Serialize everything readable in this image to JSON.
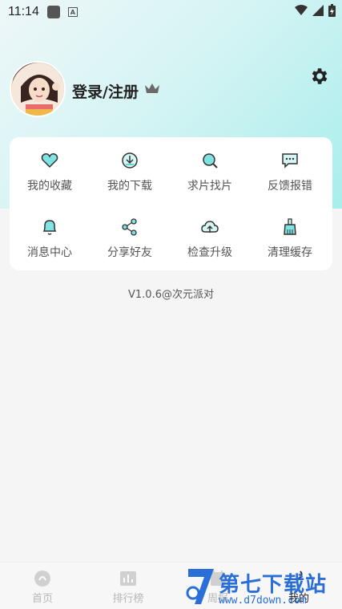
{
  "status_bar": {
    "time": "11:14",
    "a_badge": "A"
  },
  "profile": {
    "login_label": "登录/注册"
  },
  "grid": [
    {
      "label": "我的收藏",
      "icon": "heart-icon"
    },
    {
      "label": "我的下载",
      "icon": "download-icon"
    },
    {
      "label": "求片找片",
      "icon": "search-film-icon"
    },
    {
      "label": "反馈报错",
      "icon": "feedback-icon"
    },
    {
      "label": "消息中心",
      "icon": "bell-icon"
    },
    {
      "label": "分享好友",
      "icon": "share-icon"
    },
    {
      "label": "检查升级",
      "icon": "upgrade-icon"
    },
    {
      "label": "清理缓存",
      "icon": "broom-icon"
    }
  ],
  "version": "V1.0.6@次元派对",
  "tabs": [
    {
      "label": "首页",
      "icon": "home-icon",
      "active": false
    },
    {
      "label": "排行榜",
      "icon": "chart-icon",
      "active": false
    },
    {
      "label": "周报",
      "icon": "calendar-icon",
      "active": false
    },
    {
      "label": "我的",
      "icon": "user-icon",
      "active": true
    }
  ],
  "watermark": {
    "title": "第七下载站",
    "url": "www.d7down.com"
  },
  "colors": {
    "accent": "#2a7fd8",
    "icon_teal": "#5fd6d6",
    "gradient_end": "#a8eeec"
  }
}
